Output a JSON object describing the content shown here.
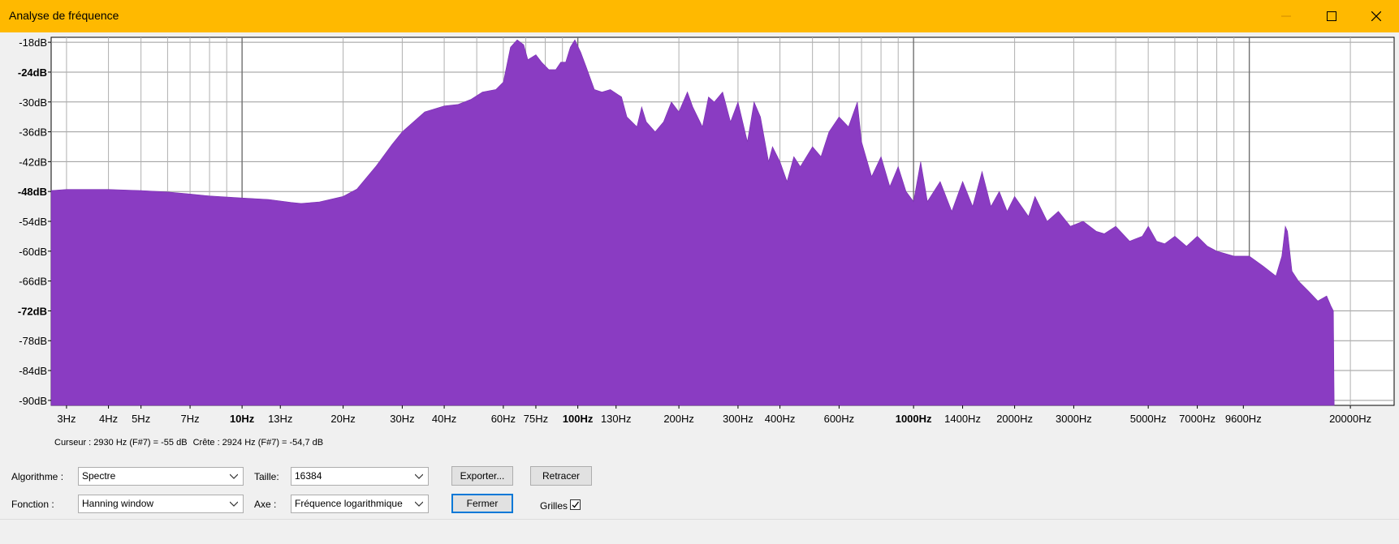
{
  "window": {
    "title": "Analyse de fréquence",
    "accent_color": "#ffb900",
    "controls": [
      "minimize-icon",
      "maximize-icon",
      "close-icon"
    ]
  },
  "chart_data": {
    "type": "area",
    "title": "",
    "xlabel": "",
    "ylabel": "",
    "x_scale": "log",
    "xlim": [
      2.7,
      27000
    ],
    "ylim": [
      -91,
      -17
    ],
    "grid": true,
    "fill_color": "#8a3cc2",
    "y_ticks": [
      {
        "label": "-18dB",
        "value": -18,
        "bold": false
      },
      {
        "label": "-24dB",
        "value": -24,
        "bold": true
      },
      {
        "label": "-30dB",
        "value": -30,
        "bold": false
      },
      {
        "label": "-36dB",
        "value": -36,
        "bold": false
      },
      {
        "label": "-42dB",
        "value": -42,
        "bold": false
      },
      {
        "label": "-48dB",
        "value": -48,
        "bold": true
      },
      {
        "label": "-54dB",
        "value": -54,
        "bold": false
      },
      {
        "label": "-60dB",
        "value": -60,
        "bold": false
      },
      {
        "label": "-66dB",
        "value": -66,
        "bold": false
      },
      {
        "label": "-72dB",
        "value": -72,
        "bold": true
      },
      {
        "label": "-78dB",
        "value": -78,
        "bold": false
      },
      {
        "label": "-84dB",
        "value": -84,
        "bold": false
      },
      {
        "label": "-90dB",
        "value": -90,
        "bold": false
      }
    ],
    "x_ticks": [
      {
        "label": "3Hz",
        "value": 3,
        "bold": false,
        "small": false
      },
      {
        "label": "4Hz",
        "value": 4,
        "bold": false,
        "small": false
      },
      {
        "label": "5Hz",
        "value": 5,
        "bold": false,
        "small": false
      },
      {
        "label": "7Hz",
        "value": 7,
        "bold": false,
        "small": false
      },
      {
        "label": "10Hz",
        "value": 10,
        "bold": true,
        "small": false
      },
      {
        "label": "13Hz",
        "value": 13,
        "bold": false,
        "small": true
      },
      {
        "label": "20Hz",
        "value": 20,
        "bold": false,
        "small": false
      },
      {
        "label": "30Hz",
        "value": 30,
        "bold": false,
        "small": false
      },
      {
        "label": "40Hz",
        "value": 40,
        "bold": false,
        "small": false
      },
      {
        "label": "60Hz",
        "value": 60,
        "bold": false,
        "small": false
      },
      {
        "label": "75Hz",
        "value": 75,
        "bold": false,
        "small": true
      },
      {
        "label": "100Hz",
        "value": 100,
        "bold": true,
        "small": false
      },
      {
        "label": "130Hz",
        "value": 130,
        "bold": false,
        "small": true
      },
      {
        "label": "200Hz",
        "value": 200,
        "bold": false,
        "small": false
      },
      {
        "label": "300Hz",
        "value": 300,
        "bold": false,
        "small": false
      },
      {
        "label": "400Hz",
        "value": 400,
        "bold": false,
        "small": false
      },
      {
        "label": "600Hz",
        "value": 600,
        "bold": false,
        "small": false
      },
      {
        "label": "1000Hz",
        "value": 1000,
        "bold": true,
        "small": false
      },
      {
        "label": "1400Hz",
        "value": 1400,
        "bold": false,
        "small": true
      },
      {
        "label": "2000Hz",
        "value": 2000,
        "bold": false,
        "small": false
      },
      {
        "label": "3000Hz",
        "value": 3000,
        "bold": false,
        "small": false
      },
      {
        "label": "5000Hz",
        "value": 5000,
        "bold": false,
        "small": false
      },
      {
        "label": "7000Hz",
        "value": 7000,
        "bold": false,
        "small": false
      },
      {
        "label": "9600Hz",
        "value": 9600,
        "bold": false,
        "small": true
      },
      {
        "label": "20000Hz",
        "value": 20000,
        "bold": false,
        "small": false
      }
    ],
    "series": [
      {
        "values": [
          [
            2.7,
            -47.8
          ],
          [
            3,
            -47.6
          ],
          [
            4,
            -47.6
          ],
          [
            5,
            -47.8
          ],
          [
            6,
            -48.1
          ],
          [
            7,
            -48.5
          ],
          [
            8,
            -48.9
          ],
          [
            10,
            -49.3
          ],
          [
            12,
            -49.6
          ],
          [
            14,
            -50.2
          ],
          [
            15,
            -50.4
          ],
          [
            17,
            -50.1
          ],
          [
            20,
            -49
          ],
          [
            22,
            -47.5
          ],
          [
            25,
            -43
          ],
          [
            28,
            -38.5
          ],
          [
            30,
            -36
          ],
          [
            35,
            -32
          ],
          [
            40,
            -30.8
          ],
          [
            44,
            -30.5
          ],
          [
            48,
            -29.5
          ],
          [
            52,
            -28
          ],
          [
            57,
            -27.5
          ],
          [
            60,
            -26
          ],
          [
            63,
            -19
          ],
          [
            66,
            -17.5
          ],
          [
            69,
            -18.5
          ],
          [
            71,
            -21.5
          ],
          [
            75,
            -20.5
          ],
          [
            78,
            -22
          ],
          [
            82,
            -23.5
          ],
          [
            86,
            -23.5
          ],
          [
            89,
            -22
          ],
          [
            92,
            -22
          ],
          [
            95,
            -19
          ],
          [
            98,
            -17.5
          ],
          [
            102,
            -20
          ],
          [
            106,
            -23
          ],
          [
            112,
            -27.5
          ],
          [
            118,
            -28
          ],
          [
            125,
            -27.5
          ],
          [
            135,
            -29
          ],
          [
            140,
            -33
          ],
          [
            150,
            -35
          ],
          [
            155,
            -31
          ],
          [
            160,
            -34
          ],
          [
            170,
            -36
          ],
          [
            180,
            -34
          ],
          [
            190,
            -30
          ],
          [
            200,
            -32
          ],
          [
            212,
            -28
          ],
          [
            220,
            -31
          ],
          [
            235,
            -35
          ],
          [
            245,
            -29
          ],
          [
            255,
            -30
          ],
          [
            270,
            -28
          ],
          [
            285,
            -34
          ],
          [
            300,
            -30
          ],
          [
            320,
            -38
          ],
          [
            335,
            -30
          ],
          [
            350,
            -33
          ],
          [
            370,
            -42
          ],
          [
            380,
            -39
          ],
          [
            400,
            -42
          ],
          [
            420,
            -46
          ],
          [
            440,
            -41
          ],
          [
            460,
            -43
          ],
          [
            500,
            -39
          ],
          [
            530,
            -41
          ],
          [
            560,
            -36
          ],
          [
            600,
            -33
          ],
          [
            640,
            -35
          ],
          [
            680,
            -30
          ],
          [
            700,
            -38
          ],
          [
            750,
            -45
          ],
          [
            800,
            -41
          ],
          [
            850,
            -47
          ],
          [
            900,
            -43
          ],
          [
            950,
            -48
          ],
          [
            1000,
            -50
          ],
          [
            1050,
            -42
          ],
          [
            1100,
            -50
          ],
          [
            1200,
            -46
          ],
          [
            1300,
            -52
          ],
          [
            1400,
            -46
          ],
          [
            1500,
            -51
          ],
          [
            1600,
            -44
          ],
          [
            1700,
            -51
          ],
          [
            1800,
            -48
          ],
          [
            1900,
            -52
          ],
          [
            2000,
            -49
          ],
          [
            2200,
            -53
          ],
          [
            2300,
            -49
          ],
          [
            2500,
            -54
          ],
          [
            2700,
            -52
          ],
          [
            2930,
            -55
          ],
          [
            3200,
            -54
          ],
          [
            3500,
            -56
          ],
          [
            3700,
            -56.5
          ],
          [
            4000,
            -55
          ],
          [
            4400,
            -58
          ],
          [
            4800,
            -57
          ],
          [
            5000,
            -55
          ],
          [
            5300,
            -58
          ],
          [
            5600,
            -58.5
          ],
          [
            6000,
            -57
          ],
          [
            6500,
            -59
          ],
          [
            7000,
            -57
          ],
          [
            7500,
            -59
          ],
          [
            8000,
            -60
          ],
          [
            9000,
            -61
          ],
          [
            10000,
            -61
          ],
          [
            11000,
            -63
          ],
          [
            12000,
            -65
          ],
          [
            12500,
            -61
          ],
          [
            12800,
            -55
          ],
          [
            13000,
            -56
          ],
          [
            13400,
            -64
          ],
          [
            14000,
            -66
          ],
          [
            15000,
            -68
          ],
          [
            16000,
            -70
          ],
          [
            17000,
            -69
          ],
          [
            17500,
            -71
          ],
          [
            17800,
            -72
          ],
          [
            17900,
            -91
          ]
        ]
      }
    ]
  },
  "status": {
    "cursor_text": "Curseur : 2930 Hz (F#7) = -55 dB",
    "peak_text": "Crête : 2924 Hz (F#7) = -54,7 dB"
  },
  "controls": {
    "algorithm_label": "Algorithme :",
    "algorithm_value": "Spectre",
    "size_label": "Taille:",
    "size_value": "16384",
    "export_button": "Exporter...",
    "retrace_button": "Retracer",
    "function_label": "Fonction :",
    "function_value": "Hanning window",
    "axis_label": "Axe :",
    "axis_value": "Fréquence logarithmique",
    "close_button": "Fermer",
    "grids_label": "Grilles",
    "grids_checked": true
  }
}
